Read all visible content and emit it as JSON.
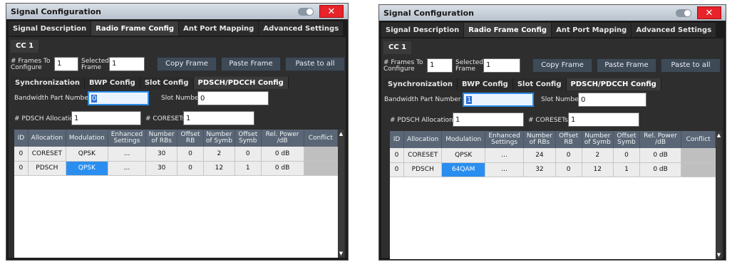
{
  "left": {
    "title": "Signal Configuration",
    "tabs": [
      "Signal Description",
      "Radio Frame Config",
      "Ant Port Mapping",
      "Advanced Settings"
    ],
    "cc": "CC 1",
    "frames_label": "# Frames To Configure",
    "frames_value": "1",
    "selected_label": "Selected Frame",
    "selected_value": "1",
    "buttons": [
      "Copy Frame",
      "Paste Frame",
      "Paste to all"
    ],
    "subtabs": [
      "Synchronization",
      "BWP Config",
      "Slot Config",
      "PDSCH/PDCCH Config"
    ],
    "bwp_label": "Bandwidth Part Number",
    "bwp_value": "0",
    "slot_label": "Slot Number",
    "slot_value": "0",
    "alloc_label": "# PDSCH Allocations",
    "alloc_value": "1",
    "coreset_label": "# CORESETs",
    "coreset_value": "1",
    "columns": [
      "ID",
      "Allocation",
      "Modulation",
      "Enhanced Settings",
      "Number of RBs",
      "Offset RB",
      "Number of Symb",
      "Offset Symb",
      "Rel. Power /dB",
      "Conflict"
    ],
    "rows": [
      [
        "0",
        "CORESET",
        "QPSK",
        "...",
        "30",
        "0",
        "2",
        "0",
        "0 dB",
        ""
      ],
      [
        "0",
        "PDSCH",
        "QPSK",
        "...",
        "30",
        "0",
        "12",
        "1",
        "0 dB",
        ""
      ]
    ]
  },
  "right": {
    "title": "Signal Configuration",
    "tabs": [
      "Signal Description",
      "Radio Frame Config",
      "Ant Port Mapping",
      "Advanced Settings"
    ],
    "cc": "CC 1",
    "frames_label": "# Frames To Configure",
    "frames_value": "1",
    "selected_label": "Selected Frame",
    "selected_value": "1",
    "buttons": [
      "Copy Frame",
      "Paste Frame",
      "Paste to all"
    ],
    "subtabs": [
      "Synchronization",
      "BWP Config",
      "Slot Config",
      "PDSCH/PDCCH Config"
    ],
    "bwp_label": "Bandwidth Part Number",
    "bwp_value": "1",
    "slot_label": "Slot Number",
    "slot_value": "0",
    "alloc_label": "# PDSCH Allocations",
    "alloc_value": "1",
    "coreset_label": "# CORESETs",
    "coreset_value": "1",
    "columns": [
      "ID",
      "Allocation",
      "Modulation",
      "Enhanced Settings",
      "Number of RBs",
      "Offset RB",
      "Number of Symb",
      "Offset Symb",
      "Rel. Power /dB",
      "Conflict"
    ],
    "rows": [
      [
        "0",
        "CORESET",
        "QPSK",
        "...",
        "24",
        "0",
        "2",
        "0",
        "0 dB",
        ""
      ],
      [
        "0",
        "PDSCH",
        "64QAM",
        "...",
        "32",
        "0",
        "12",
        "1",
        "0 dB",
        ""
      ]
    ]
  },
  "icons": {
    "close": "close-icon",
    "toggle": "toggle-icon",
    "scroll_up": "scroll-up-icon",
    "scroll_down": "scroll-down-icon"
  }
}
